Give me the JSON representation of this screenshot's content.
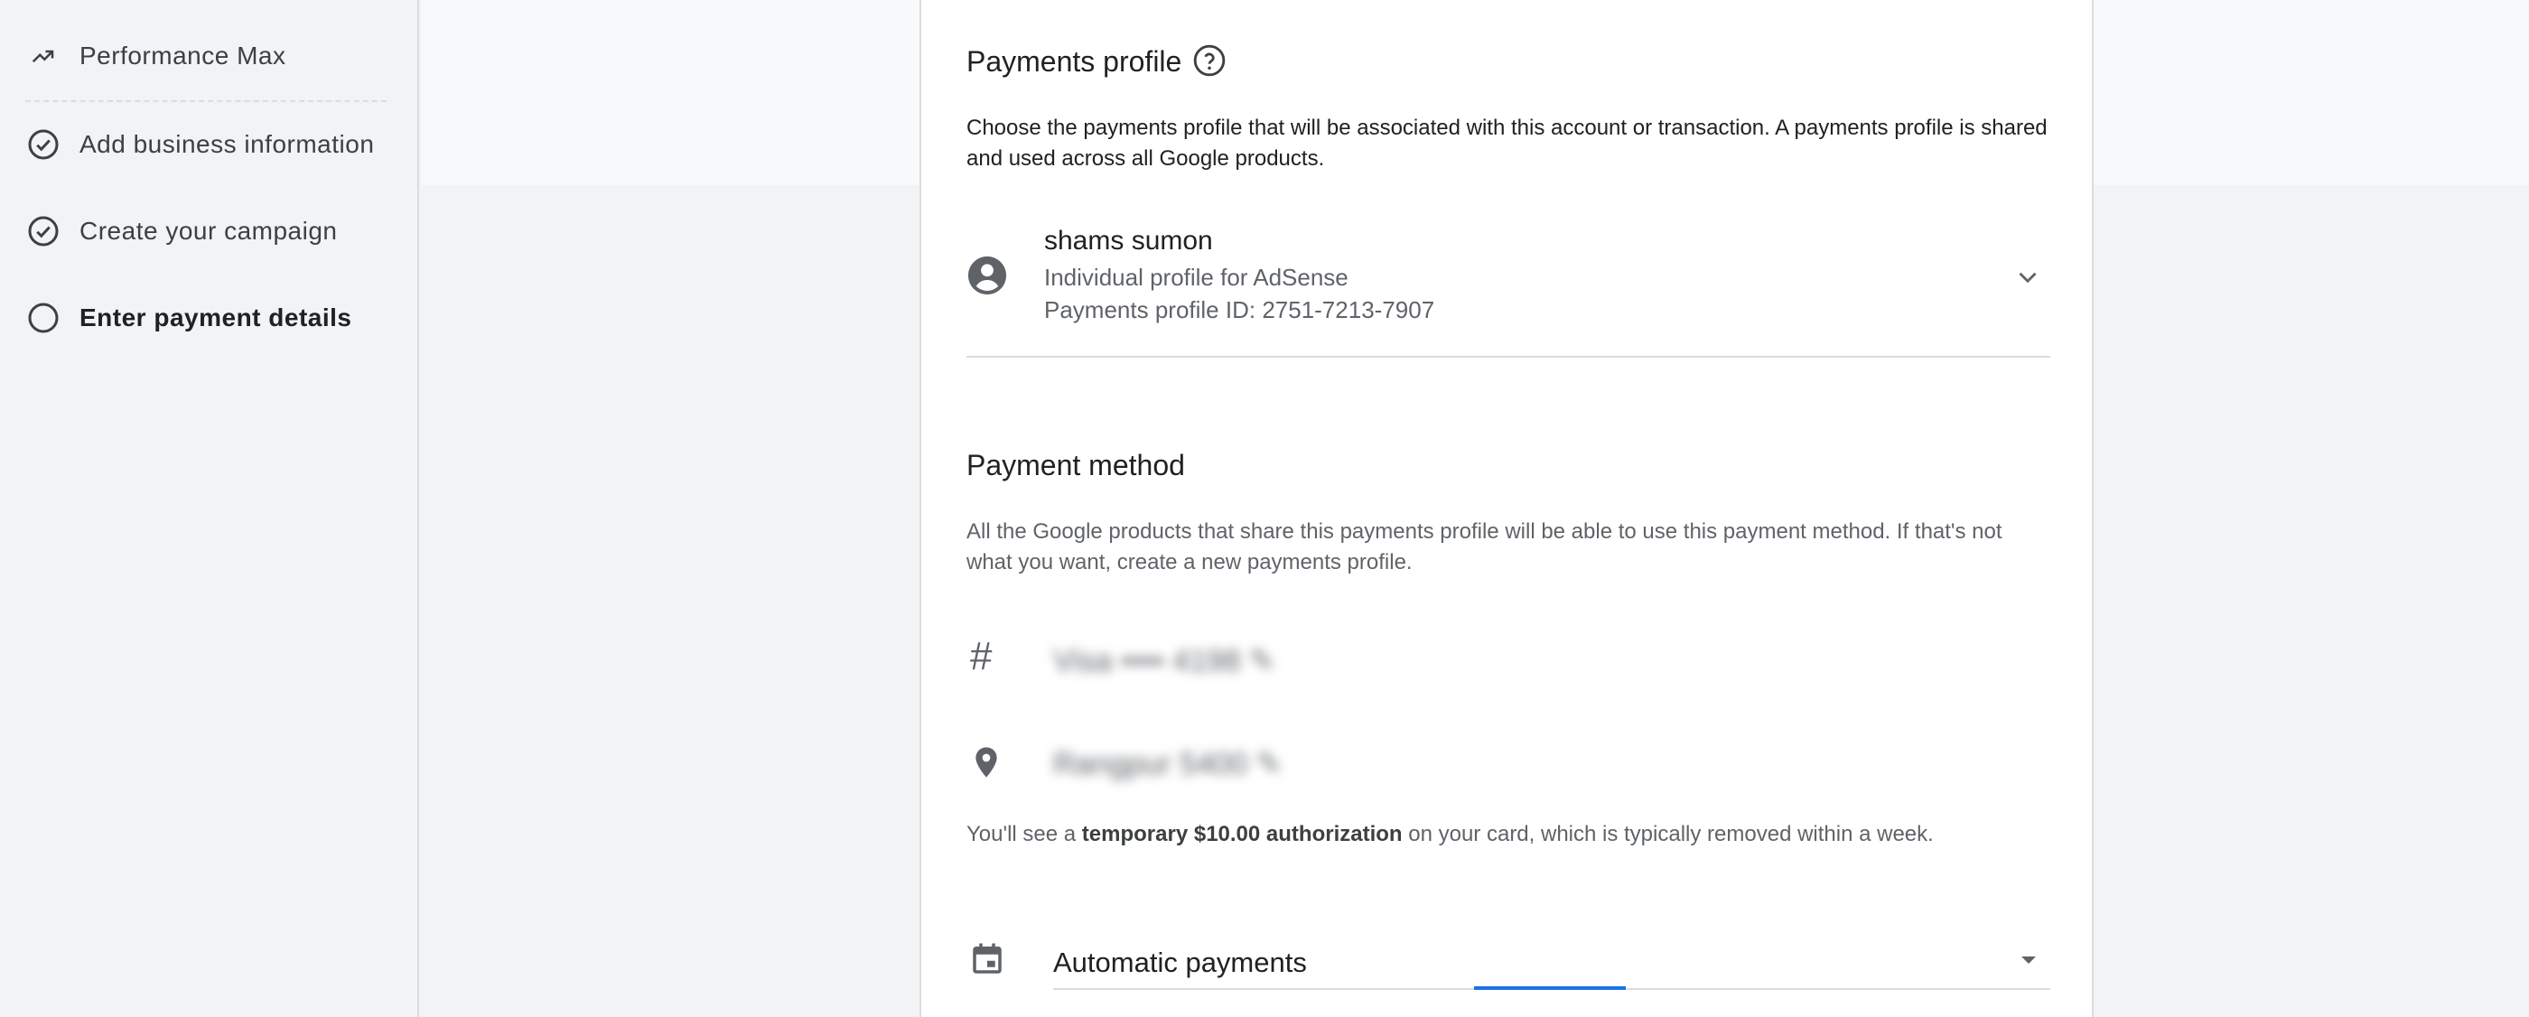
{
  "sidebar": {
    "steps": [
      {
        "label": "Performance Max",
        "icon": "trending-up-icon",
        "state": "done"
      },
      {
        "label": "Add business information",
        "icon": "check-circle-icon",
        "state": "done"
      },
      {
        "label": "Create your campaign",
        "icon": "check-circle-icon",
        "state": "done"
      },
      {
        "label": "Enter payment details",
        "icon": "empty-circle-icon",
        "state": "current"
      }
    ]
  },
  "payments_profile": {
    "title": "Payments profile",
    "description": "Choose the payments profile that will be associated with this account or transaction. A payments profile is shared and used across all Google products.",
    "name": "shams sumon",
    "type": "Individual profile for AdSense",
    "id_text": "Payments profile ID: 2751-7213-7907"
  },
  "payment_method": {
    "title": "Payment method",
    "description": "All the Google products that share this payments profile will be able to use this payment method. If that's not what you want, create a new payments profile.",
    "card_number_blurred": "Visa •••• 4198 ✎",
    "address_blurred": "Rangpur 5400 ✎",
    "auth_prefix": "You'll see a ",
    "auth_bold": "temporary $10.00 authorization",
    "auth_suffix": " on your card, which is typically removed within a week.",
    "payment_setting": "Automatic payments"
  },
  "colors": {
    "accent": "#1a73e8",
    "icon_grey": "#5f6368"
  }
}
